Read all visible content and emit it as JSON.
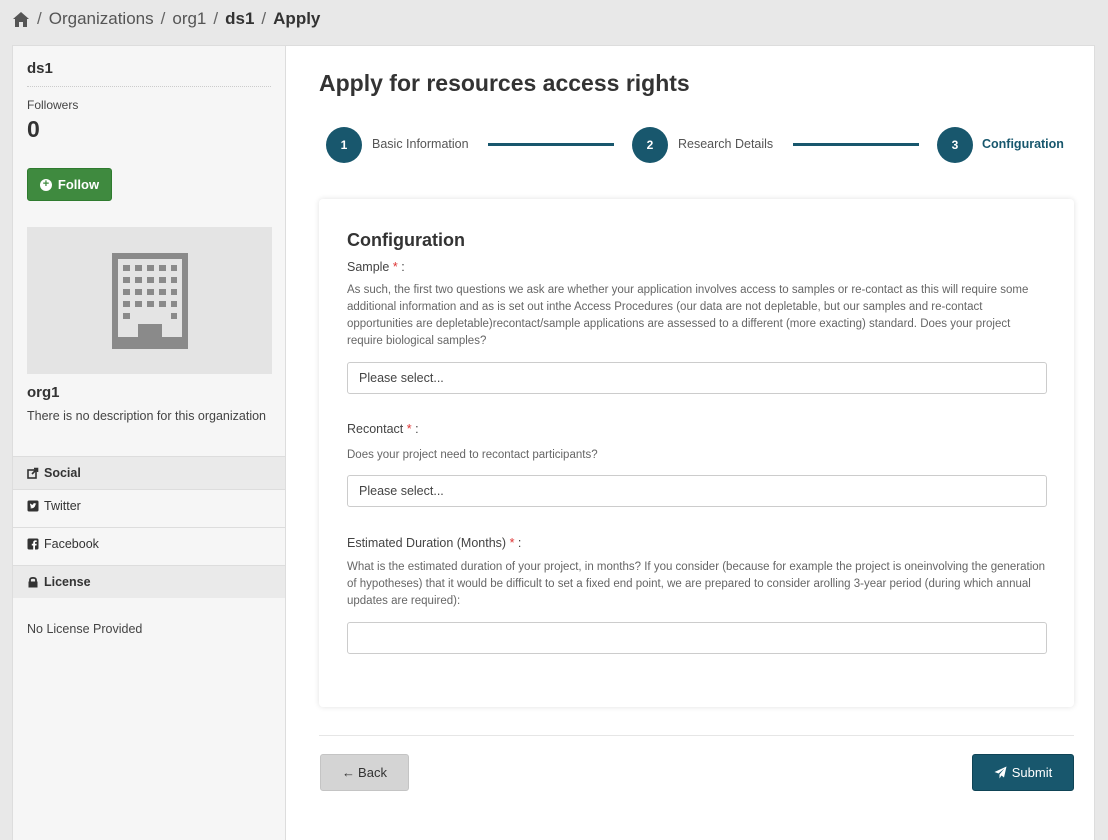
{
  "breadcrumb": {
    "home_icon": "home-icon",
    "items": [
      "Organizations",
      "org1",
      "ds1",
      "Apply"
    ]
  },
  "sidebar": {
    "title": "ds1",
    "followers_label": "Followers",
    "followers_count": "0",
    "follow_button": "Follow",
    "org_image_icon": "building-icon",
    "org_name": "org1",
    "org_description": "There is no description for this organization",
    "social_header": "Social",
    "social_items": [
      "Twitter",
      "Facebook"
    ],
    "license_header": "License",
    "license_text": "No License Provided"
  },
  "main": {
    "title": "Apply for resources access rights",
    "steps": [
      {
        "number": "1",
        "label": "Basic Information"
      },
      {
        "number": "2",
        "label": "Research Details"
      },
      {
        "number": "3",
        "label": "Configuration"
      }
    ],
    "active_step": 3,
    "form": {
      "title": "Configuration",
      "fields": [
        {
          "label": "Sample",
          "required_mark": "*",
          "suffix": " :",
          "help": "As such, the first two questions we ask are whether your application involves access to samples or re-contact as this will require some additional information and as is set out inthe Access Procedures (our data are not depletable, but our samples and re-contact opportunities are depletable)recontact/sample applications are assessed to a different (more exacting) standard. Does your project require biological samples?",
          "value": "Please select..."
        },
        {
          "label": "Recontact",
          "required_mark": "*",
          "suffix": " :",
          "help": "Does your project need to recontact participants?",
          "value": "Please select..."
        },
        {
          "label": "Estimated Duration (Months)",
          "required_mark": "*",
          "suffix": " :",
          "help": "What is the estimated duration of your project, in months? If you consider (because for example the project is oneinvolving the generation of hypotheses) that it would be difficult to set a fixed end point, we are prepared to consider arolling 3-year period (during which annual updates are required):",
          "value": ""
        }
      ]
    },
    "back_button": "Back",
    "submit_button": "Submit"
  },
  "colors": {
    "primary": "#18576d",
    "follow_green": "#3f8a3f",
    "required_red": "#d33333"
  }
}
